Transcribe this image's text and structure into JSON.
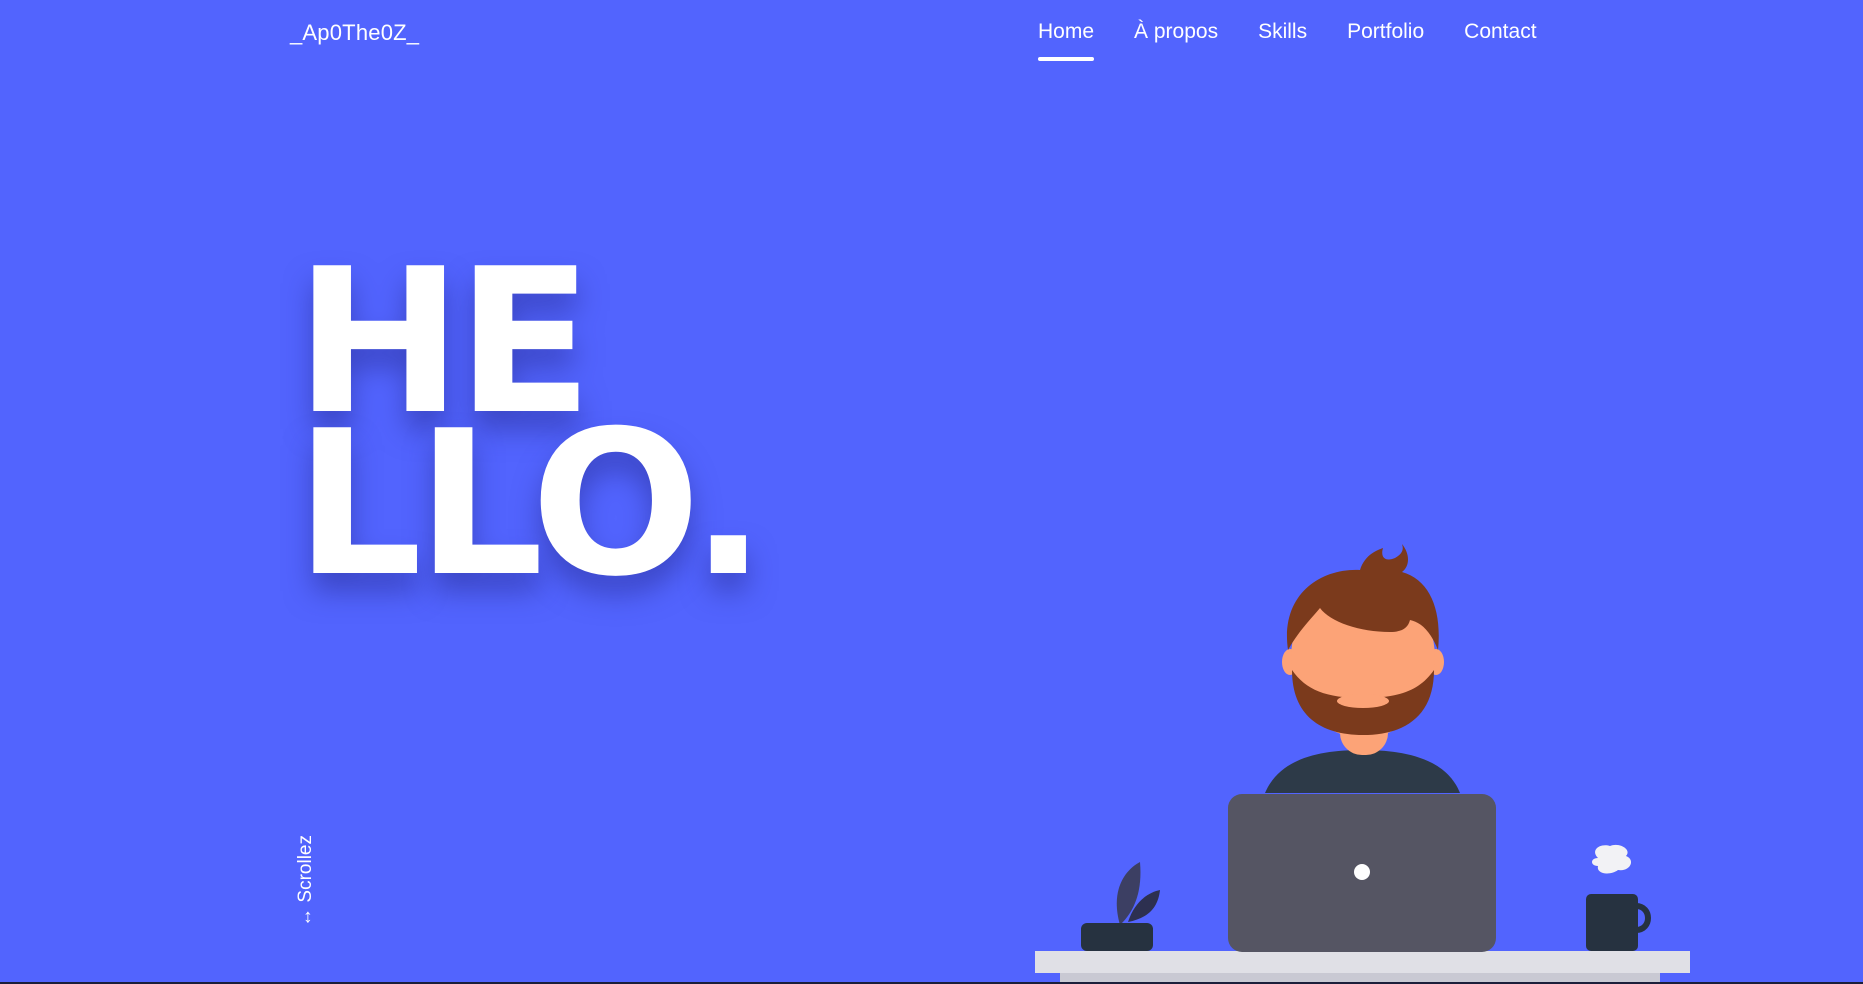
{
  "header": {
    "brand": "_Ap0The0Z_",
    "nav": [
      {
        "label": "Home",
        "active": true
      },
      {
        "label": "À propos",
        "active": false
      },
      {
        "label": "Skills",
        "active": false
      },
      {
        "label": "Portfolio",
        "active": false
      },
      {
        "label": "Contact",
        "active": false
      }
    ]
  },
  "hero": {
    "line1": "HE",
    "line2": "LLO.",
    "scroll_hint": "↔ Scrollez"
  },
  "colors": {
    "background": "#5264fe",
    "text": "#ffffff",
    "hair": "#7b3a1c",
    "skin": "#fca377",
    "shirt": "#2d3a48",
    "laptop": "#555563",
    "desk": "#e0e0e6"
  },
  "icons": {
    "illustration": "developer-at-laptop-illustration"
  }
}
